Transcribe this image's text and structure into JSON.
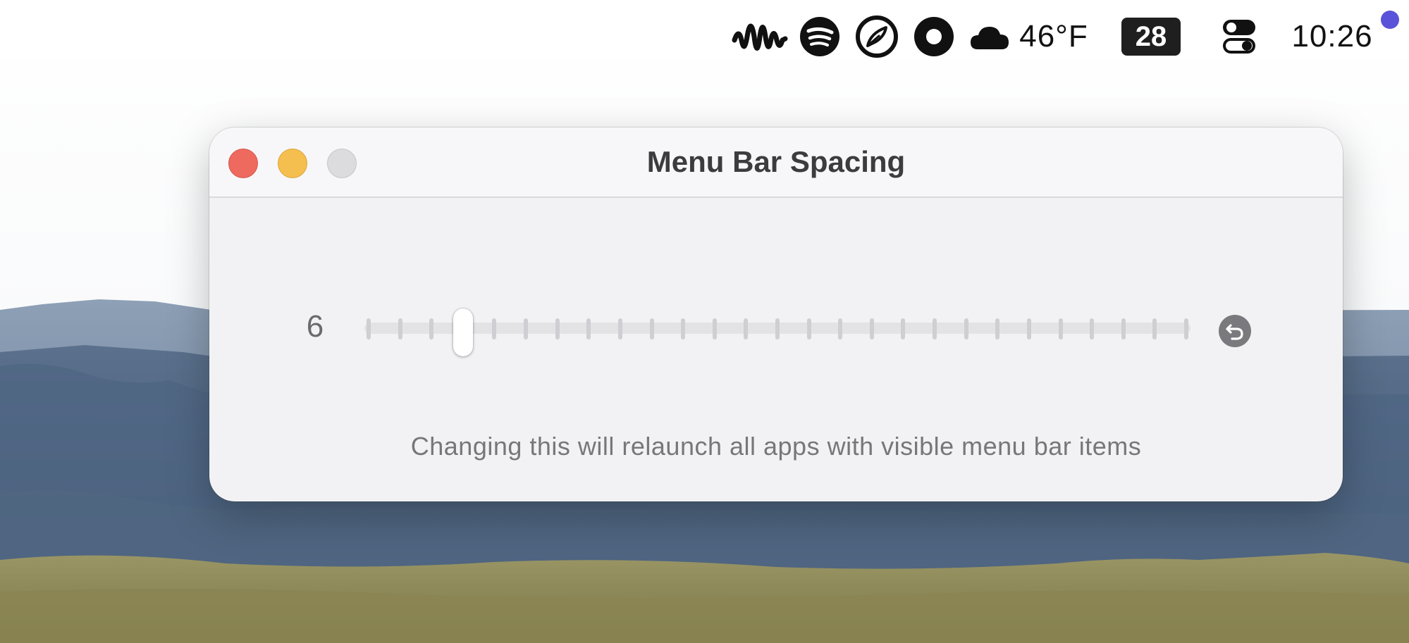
{
  "menubar": {
    "items": [
      {
        "name": "waveform-icon"
      },
      {
        "name": "spotify-icon"
      },
      {
        "name": "feather-icon"
      },
      {
        "name": "record-icon"
      },
      {
        "name": "cloud-icon"
      }
    ],
    "temperature": "46°F",
    "date": "28",
    "control_center_icon": "toggle-switches-icon",
    "clock": "10:26",
    "notification_dot_color": "#5a52d8"
  },
  "window": {
    "title": "Menu Bar Spacing",
    "slider": {
      "value_label": "6",
      "value": 3,
      "min": 0,
      "max": 26,
      "tick_count": 27,
      "reset_icon": "undo-arrow-icon"
    },
    "note": "Changing this will relaunch all apps with visible menu bar items"
  },
  "colors": {
    "close": "#ee6a5f",
    "minimize": "#f5bf4f",
    "zoom_inactive": "#dcdcde",
    "window_bg": "#f2f2f4",
    "accent_dot": "#5a52d8"
  }
}
